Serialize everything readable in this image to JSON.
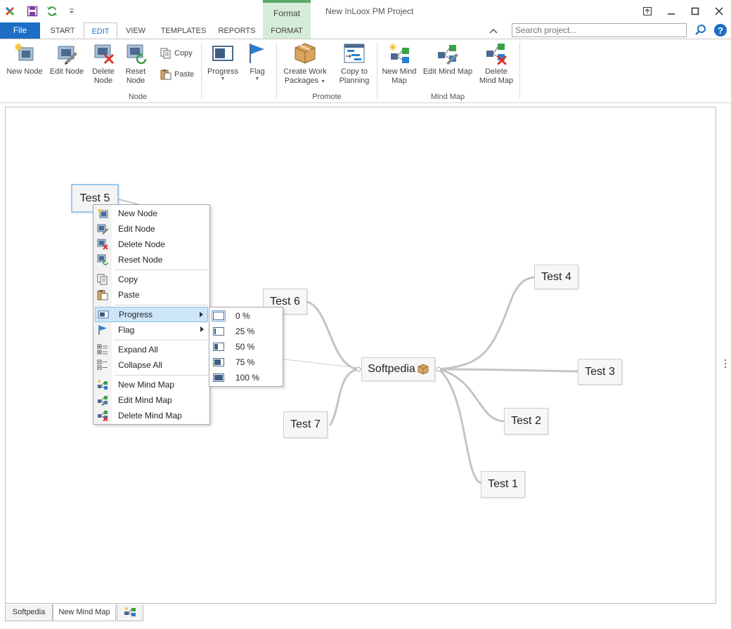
{
  "window": {
    "title": "New InLoox PM Project",
    "contextual_tab_group": "Format"
  },
  "tabs": {
    "file": "File",
    "items": [
      "START",
      "EDIT",
      "VIEW",
      "TEMPLATES",
      "REPORTS",
      "FORMAT"
    ],
    "active": "EDIT"
  },
  "search": {
    "placeholder": "Search project..."
  },
  "ribbon": {
    "node_group": {
      "label": "Node",
      "new_node": "New Node",
      "edit_node": "Edit Node",
      "delete_node_1": "Delete",
      "delete_node_2": "Node",
      "reset_node_1": "Reset",
      "reset_node_2": "Node",
      "copy": "Copy",
      "paste": "Paste",
      "progress": "Progress",
      "flag": "Flag"
    },
    "promote_group": {
      "label": "Promote",
      "create_work_1": "Create Work",
      "create_work_2": "Packages",
      "copy_planning_1": "Copy to",
      "copy_planning_2": "Planning"
    },
    "mindmap_group": {
      "label": "Mind Map",
      "new_map_1": "New Mind",
      "new_map_2": "Map",
      "edit_map": "Edit Mind Map",
      "delete_map_1": "Delete",
      "delete_map_2": "Mind Map"
    }
  },
  "mindmap": {
    "root": "Softpedia",
    "nodes": {
      "test1": "Test 1",
      "test2": "Test 2",
      "test3": "Test 3",
      "test4": "Test 4",
      "test5": "Test 5",
      "test6": "Test 6",
      "test7": "Test 7"
    }
  },
  "context_menu": {
    "new_node": "New Node",
    "edit_node": "Edit Node",
    "delete_node": "Delete Node",
    "reset_node": "Reset Node",
    "copy": "Copy",
    "paste": "Paste",
    "progress": "Progress",
    "flag": "Flag",
    "expand_all": "Expand All",
    "collapse_all": "Collapse All",
    "new_mind_map": "New Mind Map",
    "edit_mind_map": "Edit Mind Map",
    "delete_mind_map": "Delete Mind Map"
  },
  "progress_submenu": [
    {
      "label": "0 %",
      "value": 0,
      "selected": true
    },
    {
      "label": "25 %",
      "value": 25,
      "selected": false
    },
    {
      "label": "50 %",
      "value": 50,
      "selected": false
    },
    {
      "label": "75 %",
      "value": 75,
      "selected": false
    },
    {
      "label": "100 %",
      "value": 100,
      "selected": false
    }
  ],
  "bottom_tabs": {
    "tab1": "Softpedia",
    "tab2": "New Mind Map"
  },
  "colors": {
    "accent": "#1d6ec4",
    "format_tab": "#d5ecd8",
    "menu_highlight": "#cde6f7"
  }
}
